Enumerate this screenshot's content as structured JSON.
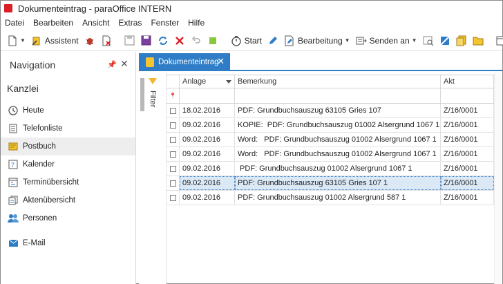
{
  "window": {
    "title": "Dokumenteintrag - paraOffice INTERN",
    "accent": "#2e7dc6"
  },
  "menu": [
    "Datei",
    "Bearbeiten",
    "Ansicht",
    "Extras",
    "Fenster",
    "Hilfe"
  ],
  "toolbar": {
    "assistent": "Assistent",
    "start": "Start",
    "bearbeitung": "Bearbeitung",
    "senden": "Senden an"
  },
  "navigation": {
    "title": "Navigation",
    "section": "Kanzlei",
    "items": [
      {
        "label": "Heute",
        "icon": "clock-icon"
      },
      {
        "label": "Telefonliste",
        "icon": "phonebook-icon"
      },
      {
        "label": "Postbuch",
        "icon": "mail-folder-icon",
        "selected": true
      },
      {
        "label": "Kalender",
        "icon": "calendar-icon"
      },
      {
        "label": "Terminübersicht",
        "icon": "schedule-icon"
      },
      {
        "label": "Aktenübersicht",
        "icon": "files-icon"
      },
      {
        "label": "Personen",
        "icon": "people-icon"
      },
      {
        "label": "E-Mail",
        "icon": "envelope-icon"
      }
    ]
  },
  "tab": {
    "label": "Dokumenteintrag"
  },
  "filter": {
    "label": "Filter"
  },
  "grid": {
    "columns": [
      "Anlage",
      "Bemerkung",
      "Akt"
    ],
    "rows": [
      {
        "anlage": "18.02.2016",
        "bemerkung": "PDF: Grundbuchsauszug 63105 Gries 107",
        "akt": "Z/16/0001"
      },
      {
        "anlage": "09.02.2016",
        "bemerkung": "KOPIE:  PDF: Grundbuchsauszug 01002 Alsergrund 1067 1",
        "akt": "Z/16/0001"
      },
      {
        "anlage": "09.02.2016",
        "bemerkung": "Word:   PDF: Grundbuchsauszug 01002 Alsergrund 1067 1",
        "akt": "Z/16/0001"
      },
      {
        "anlage": "09.02.2016",
        "bemerkung": "Word:   PDF: Grundbuchsauszug 01002 Alsergrund 1067 1",
        "akt": "Z/16/0001"
      },
      {
        "anlage": "09.02.2016",
        "bemerkung": " PDF: Grundbuchsauszug 01002 Alsergrund 1067 1",
        "akt": "Z/16/0001"
      },
      {
        "anlage": "09.02.2016",
        "bemerkung": "PDF: Grundbuchsauszug 63105 Gries 107 1",
        "akt": "Z/16/0001",
        "selected": true
      },
      {
        "anlage": "09.02.2016",
        "bemerkung": "PDF: Grundbuchsauszug 01002 Alsergrund 587 1",
        "akt": "Z/16/0001"
      }
    ]
  }
}
